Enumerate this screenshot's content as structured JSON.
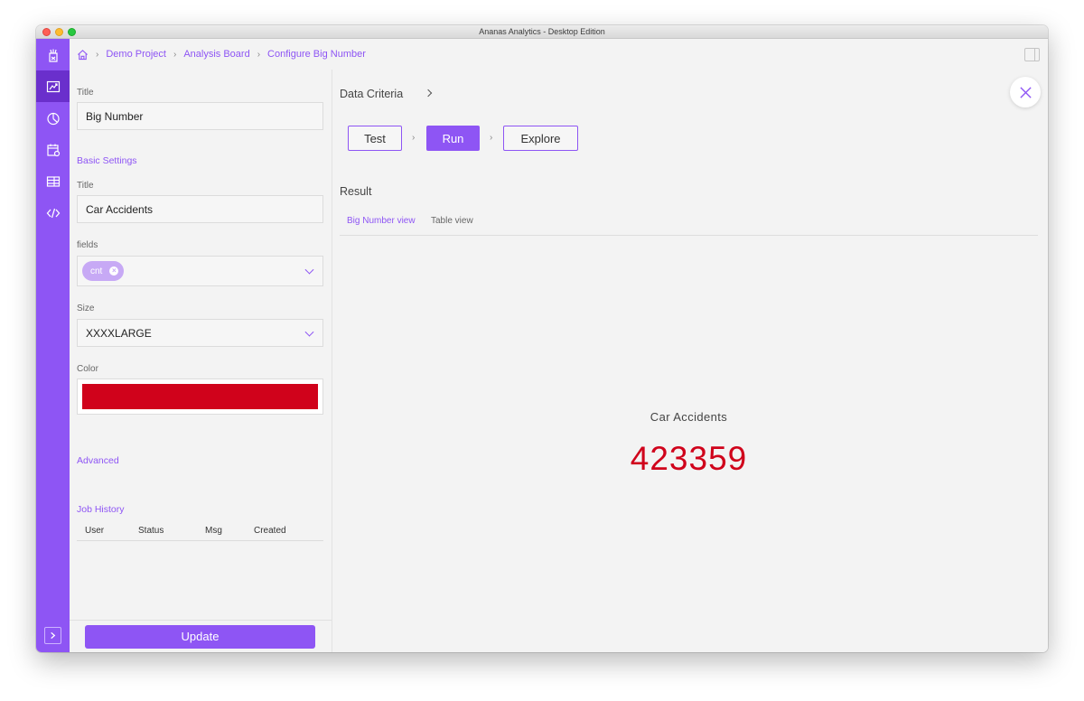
{
  "window": {
    "title": "Ananas Analytics - Desktop Edition"
  },
  "sidebar": {
    "items": [
      {
        "icon": "logo-icon"
      },
      {
        "icon": "analysis-board-icon",
        "active": true
      },
      {
        "icon": "pie-chart-icon"
      },
      {
        "icon": "calendar-icon"
      },
      {
        "icon": "table-icon"
      },
      {
        "icon": "code-icon"
      }
    ],
    "expand_icon": "chevron-right-icon"
  },
  "breadcrumb": {
    "home_icon": "home-icon",
    "items": [
      "Demo Project",
      "Analysis Board",
      "Configure Big Number"
    ]
  },
  "form": {
    "title_label": "Title",
    "title_value": "Big Number",
    "basic_settings": "Basic Settings",
    "inner_title_label": "Title",
    "inner_title_value": "Car Accidents",
    "fields_label": "fields",
    "fields_chips": [
      "cnt"
    ],
    "size_label": "Size",
    "size_value": "XXXXLARGE",
    "color_label": "Color",
    "color_value": "#d0021b",
    "advanced": "Advanced",
    "job_history": "Job History",
    "job_columns": [
      "User",
      "Status",
      "Msg",
      "Created"
    ],
    "update_label": "Update"
  },
  "main": {
    "data_criteria": "Data Criteria",
    "steps": [
      "Test",
      "Run",
      "Explore"
    ],
    "active_step": "Run",
    "result_label": "Result",
    "tabs": [
      "Big Number view",
      "Table view"
    ],
    "active_tab": "Big Number view",
    "big_number_title": "Car Accidents",
    "big_number_value": "423359"
  },
  "colors": {
    "accent": "#8e55f4",
    "accent_dark": "#6a2fcc",
    "number": "#d0021b"
  }
}
